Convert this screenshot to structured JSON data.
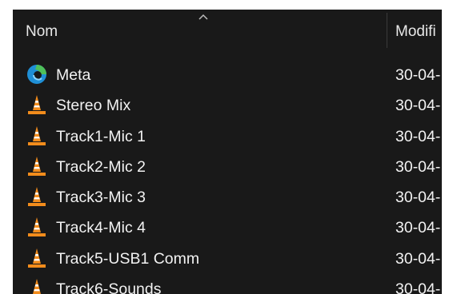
{
  "header": {
    "name_label": "Nom",
    "modified_label": "Modifi"
  },
  "files": [
    {
      "name": "Meta",
      "date": "30-04-",
      "icon": "edge-icon"
    },
    {
      "name": "Stereo Mix",
      "date": "30-04-",
      "icon": "vlc-icon"
    },
    {
      "name": "Track1-Mic 1",
      "date": "30-04-",
      "icon": "vlc-icon"
    },
    {
      "name": "Track2-Mic 2",
      "date": "30-04-",
      "icon": "vlc-icon"
    },
    {
      "name": "Track3-Mic 3",
      "date": "30-04-",
      "icon": "vlc-icon"
    },
    {
      "name": "Track4-Mic 4",
      "date": "30-04-",
      "icon": "vlc-icon"
    },
    {
      "name": "Track5-USB1 Comm",
      "date": "30-04-",
      "icon": "vlc-icon"
    },
    {
      "name": "Track6-Sounds",
      "date": "30-04-",
      "icon": "vlc-icon"
    }
  ],
  "colors": {
    "background": "#191919",
    "text": "#f2f2f2",
    "vlc_orange": "#f28c1c",
    "edge_blue": "#1f8fd6",
    "edge_green": "#4fc05a"
  }
}
